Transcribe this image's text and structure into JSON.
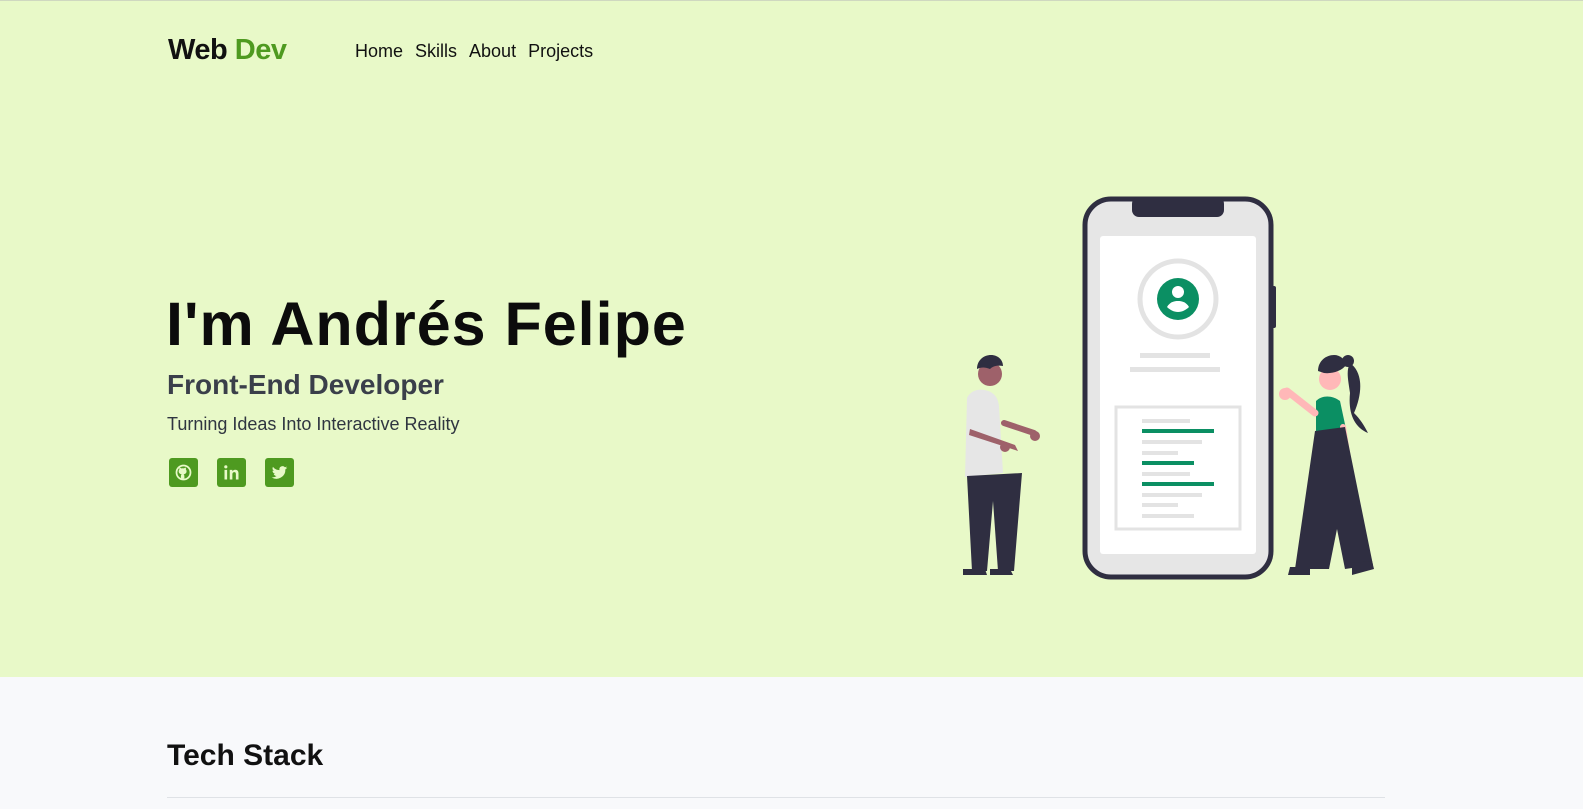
{
  "brand": {
    "part1": "Web",
    "part2": "Dev",
    "accent_color": "#4e9a20"
  },
  "nav": [
    {
      "label": "Home"
    },
    {
      "label": "Skills"
    },
    {
      "label": "About"
    },
    {
      "label": "Projects"
    }
  ],
  "hero": {
    "title": "I'm Andrés Felipe",
    "role": "Front-End Developer",
    "tagline": "Turning Ideas Into Interactive Reality",
    "background": "#e8f9c8",
    "socials": [
      {
        "icon": "github-icon"
      },
      {
        "icon": "linkedin-icon"
      },
      {
        "icon": "twitter-icon"
      }
    ]
  },
  "tech_stack": {
    "title": "Tech Stack"
  }
}
